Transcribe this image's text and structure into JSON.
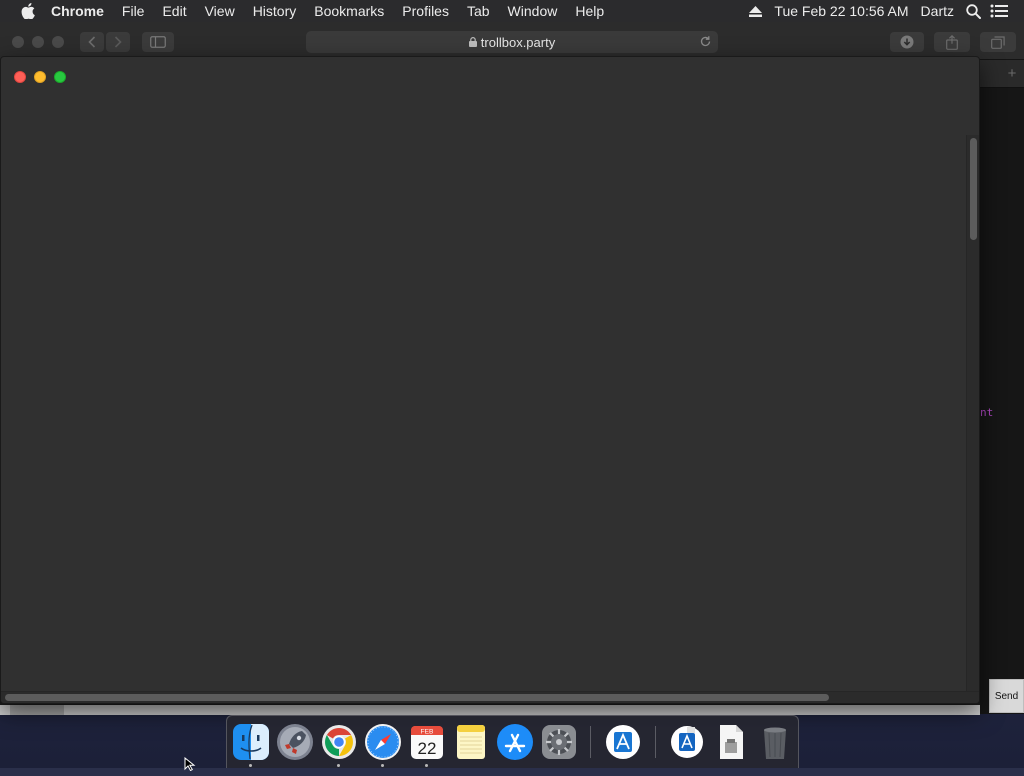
{
  "menubar": {
    "app_name": "Chrome",
    "items": [
      "File",
      "Edit",
      "View",
      "History",
      "Bookmarks",
      "Profiles",
      "Tab",
      "Window",
      "Help"
    ],
    "datetime": "Tue Feb 22  10:56 AM",
    "user": "Dartz"
  },
  "browser": {
    "address": "trollbox.party"
  },
  "background_window": {
    "side_text": "nt",
    "send_label": "Send"
  },
  "dock": {
    "items": [
      {
        "name": "Finder",
        "icon": "finder-icon",
        "running": true
      },
      {
        "name": "Launchpad",
        "icon": "launchpad-icon",
        "running": false
      },
      {
        "name": "Google Chrome",
        "icon": "chrome-icon",
        "running": true
      },
      {
        "name": "Safari",
        "icon": "safari-icon",
        "running": true
      },
      {
        "name": "Calendar",
        "icon": "calendar-icon",
        "running": true,
        "month": "FEB",
        "day": "22"
      },
      {
        "name": "Notes",
        "icon": "notes-icon",
        "running": false
      },
      {
        "name": "App Store",
        "icon": "app-store-icon",
        "running": false
      },
      {
        "name": "System Preferences",
        "icon": "system-preferences-icon",
        "running": false
      },
      {
        "name": "Xcode Installer",
        "icon": "installer-icon",
        "running": false
      },
      {
        "name": "Downloads",
        "icon": "downloads-stack-icon",
        "running": false
      },
      {
        "name": "Document",
        "icon": "document-icon",
        "running": false
      },
      {
        "name": "Trash",
        "icon": "trash-icon",
        "running": false
      }
    ]
  },
  "colors": {
    "close": "#fe5f57",
    "minimize": "#febc2e",
    "zoom": "#28c840",
    "window_bg": "#303030",
    "accent_text": "#b44ac9"
  }
}
